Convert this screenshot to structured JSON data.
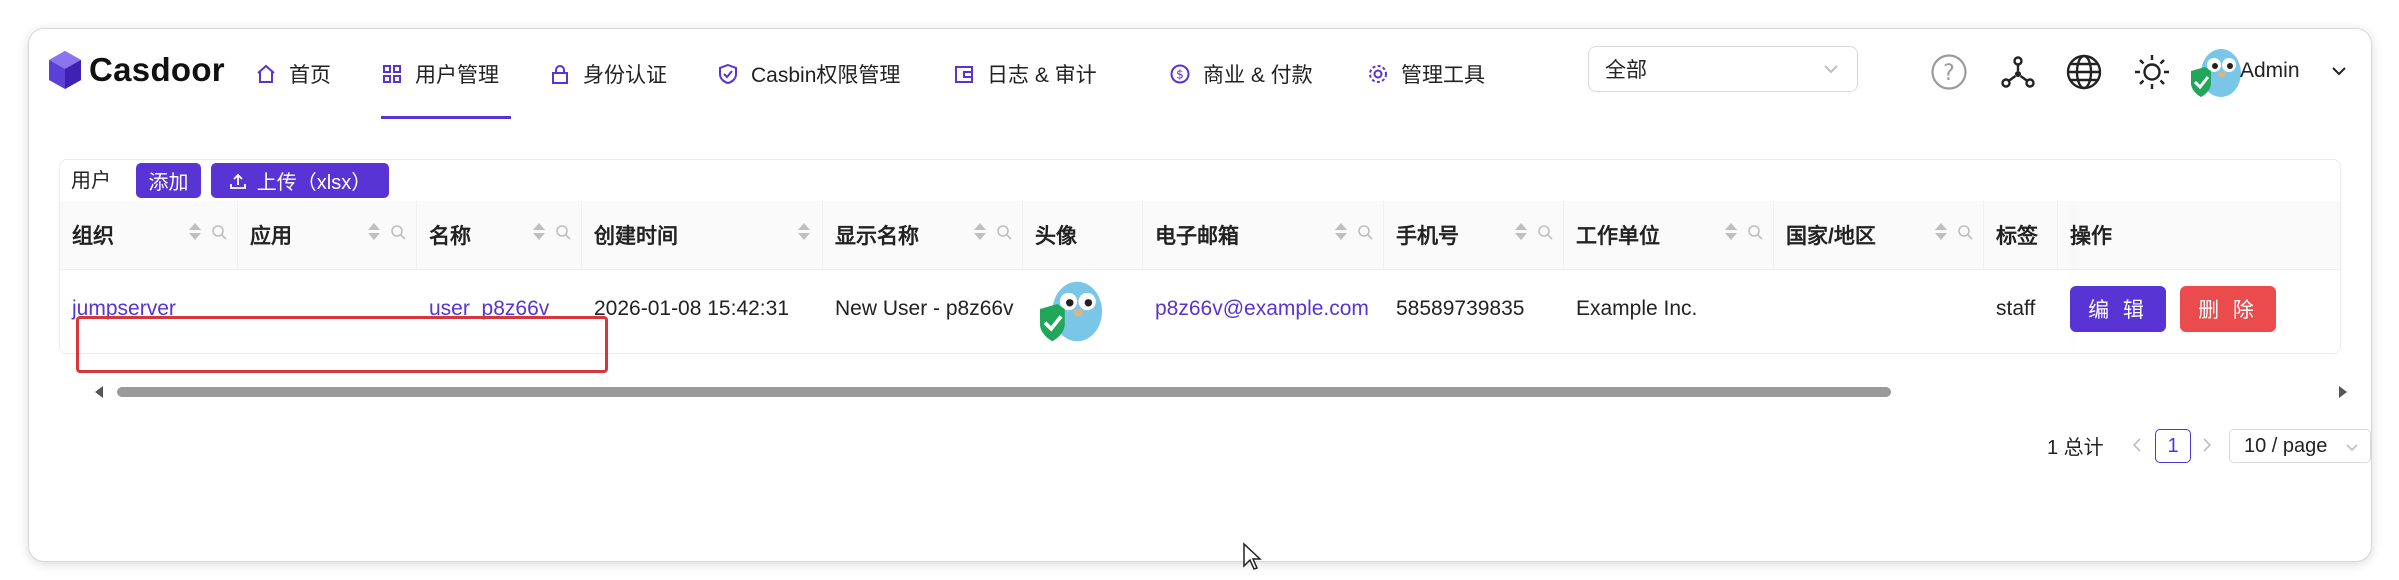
{
  "app": {
    "name": "Casdoor"
  },
  "nav": {
    "items": [
      {
        "label": "首页",
        "icon": "home-icon"
      },
      {
        "label": "用户管理",
        "icon": "grid-icon",
        "active": true
      },
      {
        "label": "身份认证",
        "icon": "lock-icon"
      },
      {
        "label": "Casbin权限管理",
        "icon": "shield-check-icon"
      },
      {
        "label": "日志 & 审计",
        "icon": "wallet-icon"
      },
      {
        "label": "商业 & 付款",
        "icon": "dollar-circle-icon"
      },
      {
        "label": "管理工具",
        "icon": "gear-icon"
      }
    ],
    "org_select": "全部",
    "user": "Admin"
  },
  "toolbar": {
    "title": "用户",
    "add_label": "添加",
    "upload_label": "上传（xlsx）"
  },
  "table": {
    "columns": [
      "组织",
      "应用",
      "名称",
      "创建时间",
      "显示名称",
      "头像",
      "电子邮箱",
      "手机号",
      "工作单位",
      "国家/地区",
      "标签",
      "操作"
    ],
    "rows": [
      {
        "organization": "jumpserver",
        "application": "",
        "name": "user_p8z66v",
        "created_time": "2026-01-08 15:42:31",
        "display_name": "New User - p8z66v",
        "email": "p8z66v@example.com",
        "phone": "58589739835",
        "affiliation": "Example Inc.",
        "region": "",
        "tag": "staff",
        "edit_label": "编 辑",
        "delete_label": "删 除"
      }
    ]
  },
  "pagination": {
    "total_text": "1 总计",
    "current_page": "1",
    "page_size": "10 / page"
  },
  "colors": {
    "accent": "#5734d3",
    "danger": "#ec4b4d",
    "highlight": "#d6373b"
  }
}
